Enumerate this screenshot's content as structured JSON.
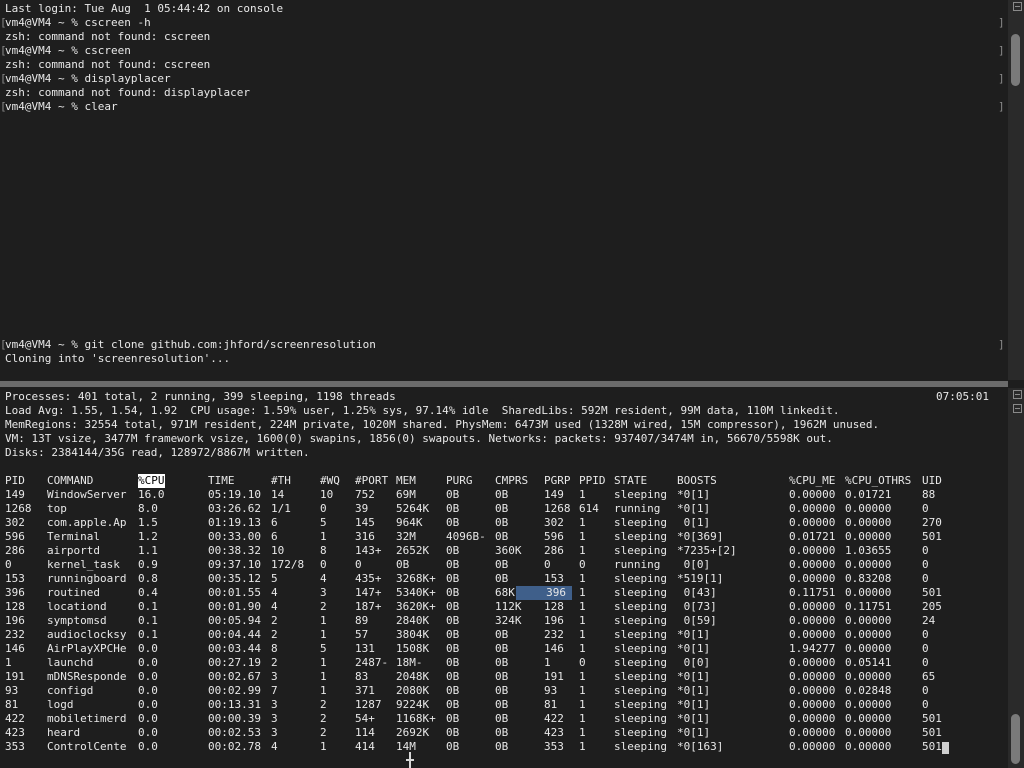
{
  "top_terminal": {
    "lines": [
      "Last login: Tue Aug  1 05:44:42 on console",
      "vm4@VM4 ~ % cscreen -h",
      "zsh: command not found: cscreen",
      "vm4@VM4 ~ % cscreen",
      "zsh: command not found: cscreen",
      "vm4@VM4 ~ % displayplacer",
      "zsh: command not found: displayplacer",
      "vm4@VM4 ~ % clear",
      "vm4@VM4 ~ % git clone github.com:jhford/screenresolution",
      "Cloning into 'screenresolution'..."
    ]
  },
  "top_monitor": {
    "summary": [
      "Processes: 401 total, 2 running, 399 sleeping, 1198 threads",
      "Load Avg: 1.55, 1.54, 1.92  CPU usage: 1.59% user, 1.25% sys, 97.14% idle  SharedLibs: 592M resident, 99M data, 110M linkedit.",
      "MemRegions: 32554 total, 971M resident, 224M private, 1020M shared. PhysMem: 6473M used (1328M wired, 15M compressor), 1962M unused.",
      "VM: 13T vsize, 3477M framework vsize, 1600(0) swapins, 1856(0) swapouts. Networks: packets: 937407/3474M in, 56670/5598K out.",
      "Disks: 2384144/35G read, 128972/8867M written."
    ],
    "clock": "07:05:01",
    "headers": [
      "PID",
      "COMMAND",
      "%CPU",
      "TIME",
      "#TH",
      "#WQ",
      "#PORT",
      "MEM",
      "PURG",
      "CMPRS",
      "PGRP",
      "PPID",
      "STATE",
      "BOOSTS",
      "%CPU_ME",
      "%CPU_OTHRS",
      "UID"
    ],
    "sorted_column": "%CPU",
    "rows": [
      [
        "149",
        "WindowServer",
        "16.0",
        "05:19.10",
        "14",
        "10",
        "752",
        "69M",
        "0B",
        "0B",
        "149",
        "1",
        "sleeping",
        "*0[1]",
        "0.00000",
        "0.01721",
        "88"
      ],
      [
        "1268",
        "top",
        "8.0",
        "03:26.62",
        "1/1",
        "0",
        "39",
        "5264K",
        "0B",
        "0B",
        "1268",
        "614",
        "running",
        "*0[1]",
        "0.00000",
        "0.00000",
        "0"
      ],
      [
        "302",
        "com.apple.Ap",
        "1.5",
        "01:19.13",
        "6",
        "5",
        "145",
        "964K",
        "0B",
        "0B",
        "302",
        "1",
        "sleeping",
        " 0[1]",
        "0.00000",
        "0.00000",
        "270"
      ],
      [
        "596",
        "Terminal",
        "1.2",
        "00:33.00",
        "6",
        "1",
        "316",
        "32M",
        "4096B-",
        "0B",
        "596",
        "1",
        "sleeping",
        "*0[369]",
        "0.01721",
        "0.00000",
        "501"
      ],
      [
        "286",
        "airportd",
        "1.1",
        "00:38.32",
        "10",
        "8",
        "143+",
        "2652K",
        "0B",
        "360K",
        "286",
        "1",
        "sleeping",
        "*7235+[2]",
        "0.00000",
        "1.03655",
        "0"
      ],
      [
        "0",
        "kernel_task",
        "0.9",
        "09:37.10",
        "172/8",
        "0",
        "0",
        "0B",
        "0B",
        "0B",
        "0",
        "0",
        "running",
        " 0[0]",
        "0.00000",
        "0.00000",
        "0"
      ],
      [
        "153",
        "runningboard",
        "0.8",
        "00:35.12",
        "5",
        "4",
        "435+",
        "3268K+",
        "0B",
        "0B",
        "153",
        "1",
        "sleeping",
        "*519[1]",
        "0.00000",
        "0.83208",
        "0"
      ],
      [
        "396",
        "routined",
        "0.4",
        "00:01.55",
        "4",
        "3",
        "147+",
        "5340K+",
        "0B",
        "68K",
        "396",
        "1",
        "sleeping",
        " 0[43]",
        "0.11751",
        "0.00000",
        "501"
      ],
      [
        "128",
        "locationd",
        "0.1",
        "00:01.90",
        "4",
        "2",
        "187+",
        "3620K+",
        "0B",
        "112K",
        "128",
        "1",
        "sleeping",
        " 0[73]",
        "0.00000",
        "0.11751",
        "205"
      ],
      [
        "196",
        "symptomsd",
        "0.1",
        "00:05.94",
        "2",
        "1",
        "89",
        "2840K",
        "0B",
        "324K",
        "196",
        "1",
        "sleeping",
        " 0[59]",
        "0.00000",
        "0.00000",
        "24"
      ],
      [
        "232",
        "audioclocksy",
        "0.1",
        "00:04.44",
        "2",
        "1",
        "57",
        "3804K",
        "0B",
        "0B",
        "232",
        "1",
        "sleeping",
        "*0[1]",
        "0.00000",
        "0.00000",
        "0"
      ],
      [
        "146",
        "AirPlayXPCHe",
        "0.0",
        "00:03.44",
        "8",
        "5",
        "131",
        "1508K",
        "0B",
        "0B",
        "146",
        "1",
        "sleeping",
        "*0[1]",
        "1.94277",
        "0.00000",
        "0"
      ],
      [
        "1",
        "launchd",
        "0.0",
        "00:27.19",
        "2",
        "1",
        "2487-",
        "18M-",
        "0B",
        "0B",
        "1",
        "0",
        "sleeping",
        " 0[0]",
        "0.00000",
        "0.05141",
        "0"
      ],
      [
        "191",
        "mDNSResponde",
        "0.0",
        "00:02.67",
        "3",
        "1",
        "83",
        "2048K",
        "0B",
        "0B",
        "191",
        "1",
        "sleeping",
        "*0[1]",
        "0.00000",
        "0.00000",
        "65"
      ],
      [
        "93",
        "configd",
        "0.0",
        "00:02.99",
        "7",
        "1",
        "371",
        "2080K",
        "0B",
        "0B",
        "93",
        "1",
        "sleeping",
        "*0[1]",
        "0.00000",
        "0.02848",
        "0"
      ],
      [
        "81",
        "logd",
        "0.0",
        "00:13.31",
        "3",
        "2",
        "1287",
        "9224K",
        "0B",
        "0B",
        "81",
        "1",
        "sleeping",
        "*0[1]",
        "0.00000",
        "0.00000",
        "0"
      ],
      [
        "422",
        "mobiletimerd",
        "0.0",
        "00:00.39",
        "3",
        "2",
        "54+",
        "1168K+",
        "0B",
        "0B",
        "422",
        "1",
        "sleeping",
        "*0[1]",
        "0.00000",
        "0.00000",
        "501"
      ],
      [
        "423",
        "heard",
        "0.0",
        "00:02.53",
        "3",
        "2",
        "114",
        "2692K",
        "0B",
        "0B",
        "423",
        "1",
        "sleeping",
        "*0[1]",
        "0.00000",
        "0.00000",
        "501"
      ],
      [
        "353",
        "ControlCente",
        "0.0",
        "00:02.78",
        "4",
        "1",
        "414",
        "14M",
        "0B",
        "0B",
        "353",
        "1",
        "sleeping",
        "*0[163]",
        "0.00000",
        "0.00000",
        "501"
      ]
    ],
    "selected_row": 7,
    "selected_col": 10
  },
  "icons": {
    "split_button": "split-pane-icon",
    "pointer": "ibeam-cursor-icon"
  },
  "colors": {
    "background": "#1e1e1e",
    "text": "#e8e8e8",
    "selection": "#3f5f8a",
    "divider": "#6b6b6b"
  }
}
